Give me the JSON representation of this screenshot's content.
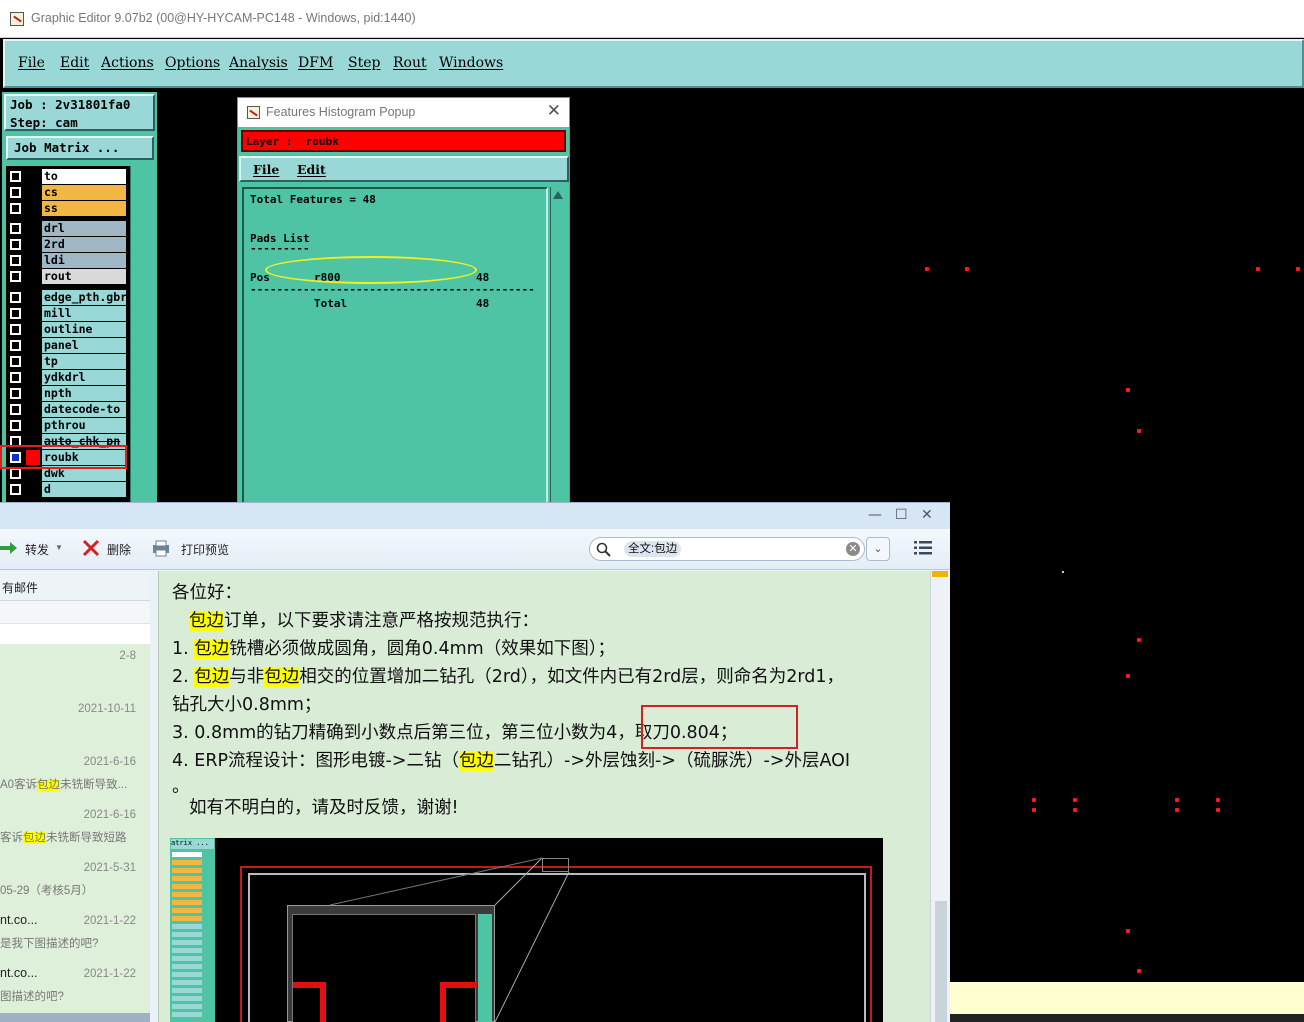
{
  "app": {
    "title": "Graphic Editor 9.07b2 (00@HY-HYCAM-PC148 - Windows, pid:1440)",
    "menu": [
      "File",
      "Edit",
      "Actions",
      "Options",
      "Analysis",
      "DFM",
      "Step",
      "Rout",
      "Windows"
    ]
  },
  "job": {
    "job_line": "Job : 2v31801fa0",
    "step_line": "Step: cam",
    "matrix_button": "Job Matrix ..."
  },
  "layers": [
    {
      "name": "to",
      "color": "#ffffff"
    },
    {
      "name": "cs",
      "color": "#f2b642"
    },
    {
      "name": "ss",
      "color": "#f2b642"
    },
    {
      "name": "drl",
      "color": "#9fb6c4"
    },
    {
      "name": "2rd",
      "color": "#9fb6c4"
    },
    {
      "name": "ldi",
      "color": "#9fb6c4"
    },
    {
      "name": "rout",
      "color": "#d9d9d9"
    },
    {
      "name": "edge_pth.gbr",
      "color": "#9ad8d8"
    },
    {
      "name": "mill",
      "color": "#9ad8d8"
    },
    {
      "name": "outline",
      "color": "#9ad8d8"
    },
    {
      "name": "panel",
      "color": "#9ad8d8"
    },
    {
      "name": "tp",
      "color": "#9ad8d8"
    },
    {
      "name": "ydkdrl",
      "color": "#9ad8d8"
    },
    {
      "name": "npth",
      "color": "#9ad8d8"
    },
    {
      "name": "datecode-to",
      "color": "#9ad8d8"
    },
    {
      "name": "pthrou",
      "color": "#9ad8d8"
    },
    {
      "name": "auto_chk_pn",
      "color": "#9ad8d8"
    },
    {
      "name": "roubk",
      "color": "#9ad8d8",
      "selected": true
    },
    {
      "name": "dwk",
      "color": "#9ad8d8"
    },
    {
      "name": "d",
      "color": "#9ad8d8"
    }
  ],
  "histogram": {
    "window_title": "Features Histogram Popup",
    "layer_label": "Layer :  roubk",
    "menu": [
      "File",
      "Edit"
    ],
    "total_features": "Total Features = 48",
    "section": "Pads List",
    "section_rule": "---------",
    "row_type": "Pos",
    "row_symbol": "r800",
    "row_count": "48",
    "divider": "-------------------------------------------",
    "total_label": "Total",
    "total_count": "48"
  },
  "mail": {
    "toolbar": {
      "forward": "转发",
      "delete": "删除",
      "print_preview": "打印预览",
      "search_tag": "全文:包边"
    },
    "list_header": "有邮件",
    "list_items": [
      {
        "from": "",
        "date": "2-8",
        "snippet": ""
      },
      {
        "from": "",
        "date": "2021-10-11",
        "snippet": ""
      },
      {
        "from": "",
        "date": "2021-6-16",
        "snippet_pre": "A0客诉",
        "snippet_hl": "包边",
        "snippet_post": "未铣断导致..."
      },
      {
        "from": "",
        "date": "2021-6-16",
        "snippet_pre": "客诉",
        "snippet_hl": "包边",
        "snippet_post": "未铣断导致短路"
      },
      {
        "from": "",
        "date": "2021-5-31",
        "snippet": "05-29（考核5月）"
      },
      {
        "from": "nt.co...",
        "date": "2021-1-22",
        "snippet": "是我下图描述的吧?"
      },
      {
        "from": "nt.co...",
        "date": "2021-1-22",
        "snippet": "图描述的吧?"
      }
    ],
    "body": {
      "greeting": "各位好：",
      "l1_hl": "包边",
      "l1_rest": "订单，以下要求请注意严格按规范执行：",
      "l2_pre": "1. ",
      "l2_hl": "包边",
      "l2_rest": "铣槽必须做成圆角，圆角0.4mm（效果如下图）；",
      "l3_pre": "2. ",
      "l3_hl": "包边",
      "l3_mid": "与非",
      "l3_hl2": "包边",
      "l3_rest": "相交的位置增加二钻孔（2rd），如文件内已有2rd层，则命名为2rd1，",
      "l4": "钻孔大小0.8mm；",
      "l5": "3. 0.8mm的钻刀精确到小数点后第三位，第三位小数为4，取刀0.804；",
      "l6_pre": "4. ERP流程设计：图形电镀->二钻（",
      "l6_hl": "包边",
      "l6_rest": "二钻孔）->外层蚀刻->（硫脲洗）->外层AOI",
      "l7": "。",
      "l8": "如有不明白的，请及时反馈，谢谢!"
    },
    "embedded_matrix_label": "atrix ..."
  }
}
